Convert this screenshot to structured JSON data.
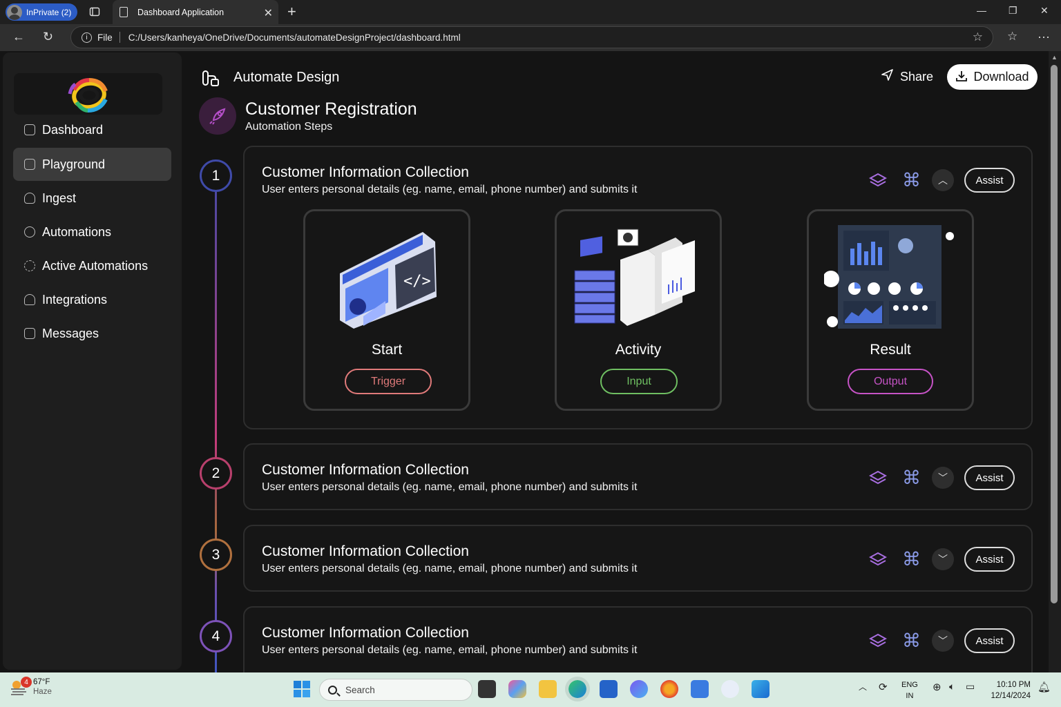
{
  "browser": {
    "profile_label": "InPrivate (2)",
    "tab_title": "Dashboard Application",
    "url_scheme_label": "File",
    "url": "C:/Users/kanheya/OneDrive/Documents/automateDesignProject/dashboard.html"
  },
  "sidebar": {
    "items": [
      {
        "label": "Dashboard",
        "active": false
      },
      {
        "label": "Playground",
        "active": true
      },
      {
        "label": "Ingest",
        "active": false
      },
      {
        "label": "Automations",
        "active": false
      },
      {
        "label": "Active Automations",
        "active": false
      },
      {
        "label": "Integrations",
        "active": false
      },
      {
        "label": "Messages",
        "active": false
      }
    ]
  },
  "header": {
    "brand": "Automate Design",
    "share_label": "Share",
    "download_label": "Download"
  },
  "page": {
    "title": "Customer Registration",
    "subtitle": "Automation Steps"
  },
  "steps": [
    {
      "number": "1",
      "title": "Customer Information Collection",
      "description": "User enters personal details (eg. name, email, phone number) and submits it",
      "expanded": true,
      "assist_label": "Assist",
      "tiles": [
        {
          "name": "Start",
          "button": "Trigger",
          "color": "#e07a7a"
        },
        {
          "name": "Activity",
          "button": "Input",
          "color": "#6fbf62"
        },
        {
          "name": "Result",
          "button": "Output",
          "color": "#c653c6"
        }
      ]
    },
    {
      "number": "2",
      "title": "Customer Information Collection",
      "description": "User enters personal details (eg. name, email, phone number) and submits it",
      "expanded": false,
      "assist_label": "Assist"
    },
    {
      "number": "3",
      "title": "Customer Information Collection",
      "description": "User enters personal details (eg. name, email, phone number) and submits it",
      "expanded": false,
      "assist_label": "Assist"
    },
    {
      "number": "4",
      "title": "Customer Information Collection",
      "description": "User enters personal details (eg. name, email, phone number) and submits it",
      "expanded": false,
      "assist_label": "Assist"
    }
  ],
  "colors": {
    "step1": "#3f4aa8",
    "step2": "#b8406c",
    "step3": "#b0703e",
    "step4": "#7d52b8",
    "icon_accent": "#8b9be8"
  },
  "taskbar": {
    "weather_temp": "67°F",
    "weather_desc": "Haze",
    "weather_badge": "4",
    "search_placeholder": "Search",
    "lang_top": "ENG",
    "lang_bottom": "IN",
    "time": "10:10 PM",
    "date": "12/14/2024"
  }
}
